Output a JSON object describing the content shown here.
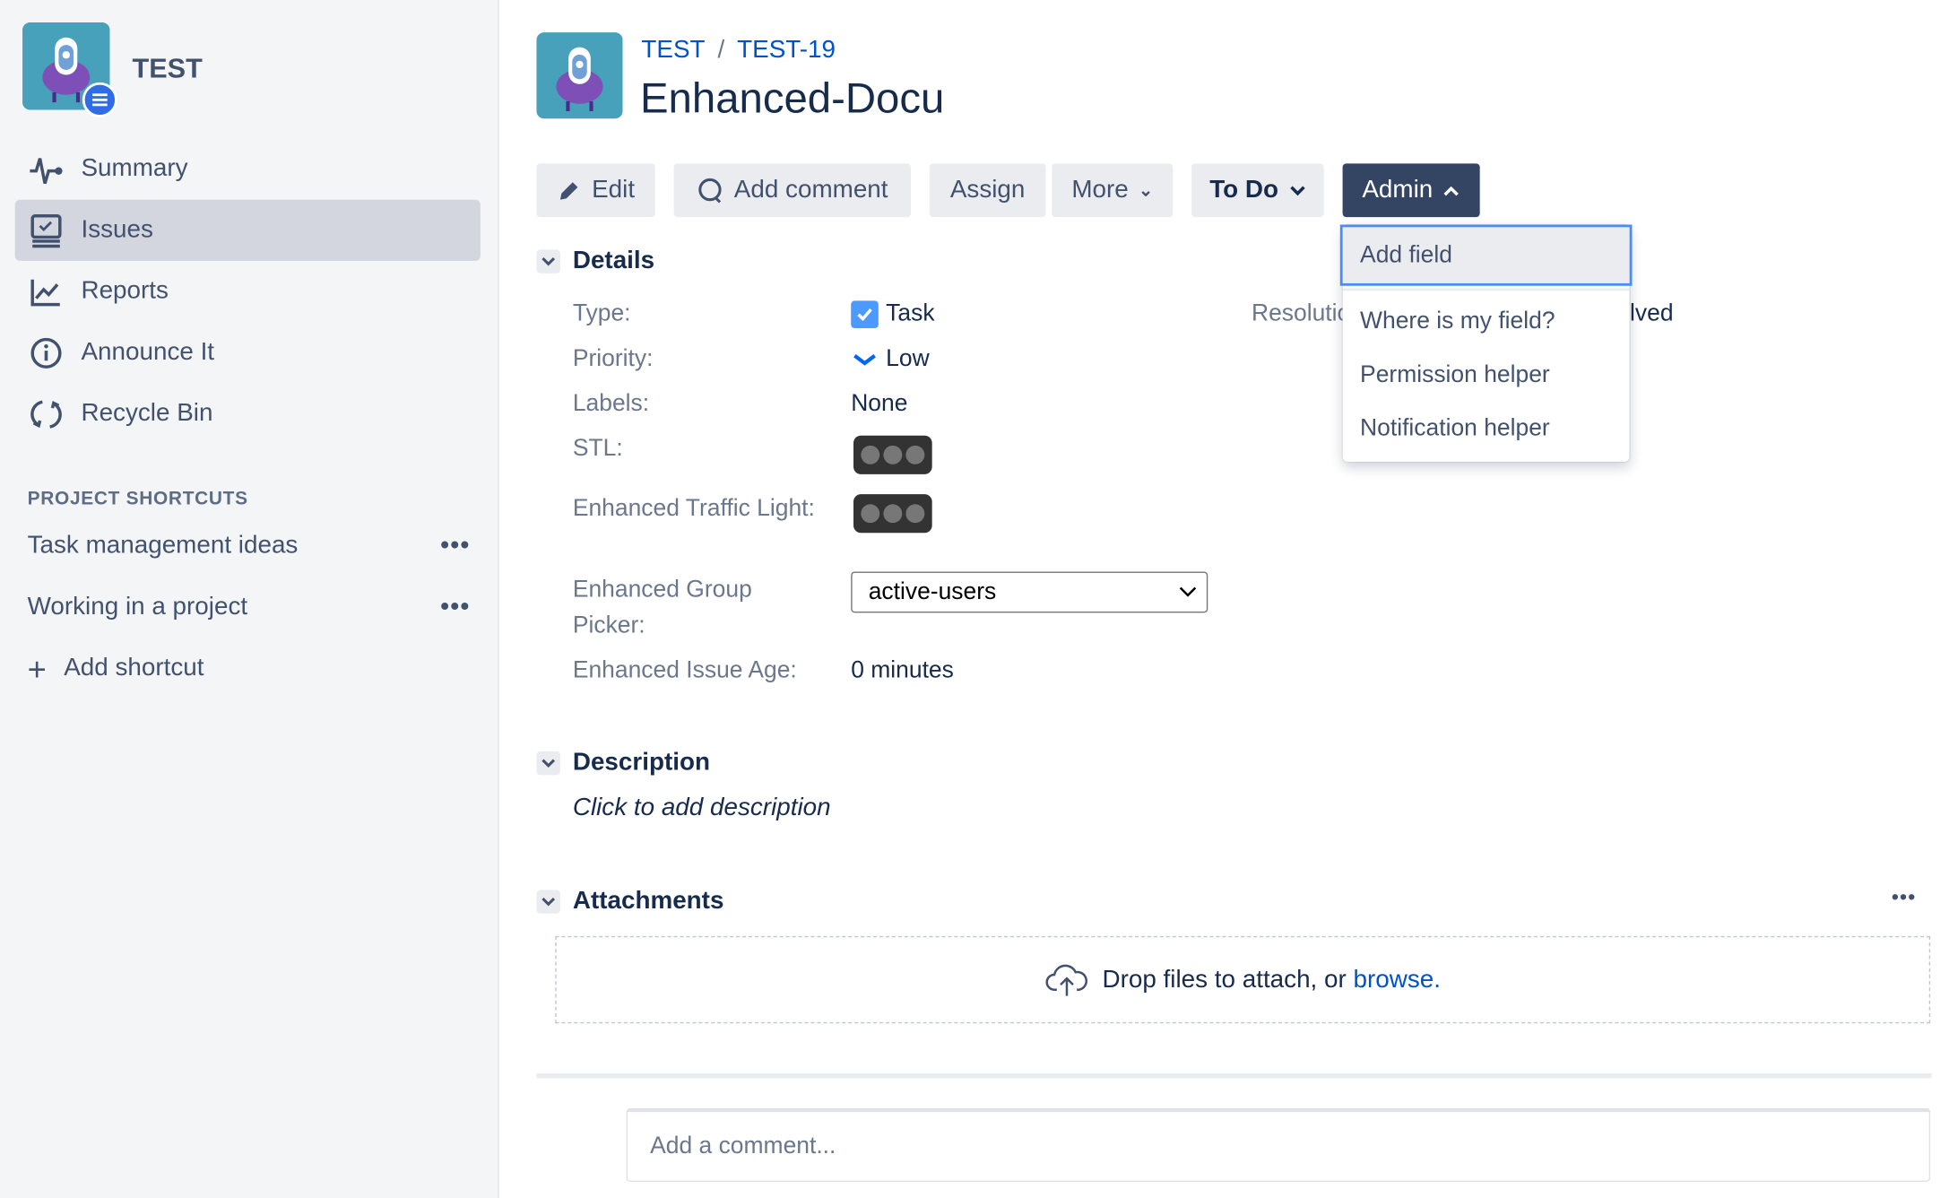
{
  "project": {
    "name": "TEST"
  },
  "sidebar": {
    "items": [
      {
        "label": "Summary",
        "icon": "activity-icon"
      },
      {
        "label": "Issues",
        "icon": "issues-icon",
        "selected": true
      },
      {
        "label": "Reports",
        "icon": "chart-icon"
      },
      {
        "label": "Announce It",
        "icon": "info-icon"
      },
      {
        "label": "Recycle Bin",
        "icon": "recycle-icon"
      }
    ],
    "shortcuts_heading": "PROJECT SHORTCUTS",
    "shortcuts": [
      {
        "label": "Task management ideas"
      },
      {
        "label": "Working in a project"
      }
    ],
    "add_shortcut": "Add shortcut"
  },
  "breadcrumb": {
    "project": "TEST",
    "sep": "/",
    "issue": "TEST-19"
  },
  "issue": {
    "title": "Enhanced-Docu"
  },
  "toolbar": {
    "edit": "Edit",
    "add_comment": "Add comment",
    "assign": "Assign",
    "more": "More",
    "status": "To Do",
    "admin": "Admin"
  },
  "admin_menu": {
    "items": [
      "Add field",
      "Where is my field?",
      "Permission helper",
      "Notification helper"
    ]
  },
  "details": {
    "heading": "Details",
    "type": {
      "label": "Type:",
      "value": "Task"
    },
    "priority": {
      "label": "Priority:",
      "value": "Low"
    },
    "labels": {
      "label": "Labels:",
      "value": "None"
    },
    "stl": {
      "label": "STL:"
    },
    "traffic": {
      "label": "Enhanced Traffic Light:"
    },
    "group": {
      "label": "Enhanced Group Picker:",
      "value": "active-users"
    },
    "age": {
      "label": "Enhanced Issue Age:",
      "value": "0 minutes"
    },
    "resolution": {
      "label": "Resolution:",
      "value": "Unresolved"
    }
  },
  "description": {
    "heading": "Description",
    "placeholder": "Click to add description"
  },
  "attachments": {
    "heading": "Attachments",
    "drop_text": "Drop files to attach, or ",
    "browse": "browse."
  },
  "comment": {
    "placeholder": "Add a comment..."
  },
  "colors": {
    "accent": "#0052cc",
    "admin_bg": "#344563",
    "focus": "#4c8cf5"
  }
}
